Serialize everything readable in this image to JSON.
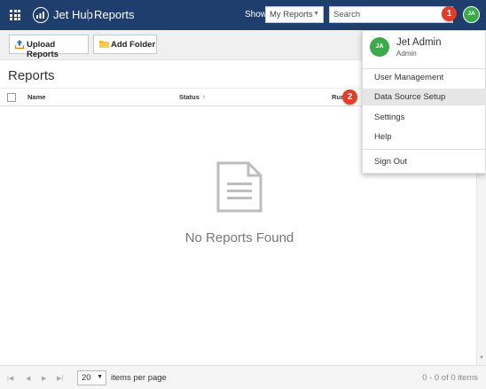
{
  "topbar": {
    "app_name": "Jet Hub",
    "section": "Reports",
    "show_label": "Show",
    "show_value": "My Reports",
    "search_placeholder": "Search",
    "avatar_initials": "JA",
    "background": "#1e3f6e"
  },
  "toolbar": {
    "upload_label": "Upload Reports",
    "add_folder_label": "Add Folder"
  },
  "main": {
    "title": "Reports",
    "columns": [
      "Name",
      "Status",
      "Run"
    ],
    "sorted_column": "Status",
    "sort_direction": "ascending",
    "empty_message": "No Reports Found"
  },
  "footer": {
    "page_size": "20",
    "per_page_label": "items per page",
    "count_text": "0 - 0 of 0 items"
  },
  "user_menu": {
    "initials": "JA",
    "name": "Jet Admin",
    "role": "Admin",
    "items": [
      "User Management",
      "Data Source Setup",
      "Settings",
      "Help"
    ],
    "highlighted_item": "Data Source Setup",
    "sign_out": "Sign Out"
  },
  "annotations": {
    "badge_1": "1",
    "badge_2": "2",
    "badge_color": "#e23c2a"
  },
  "colors": {
    "avatar": "#3caa4a",
    "sort_arrow": "#3a6fc0"
  }
}
